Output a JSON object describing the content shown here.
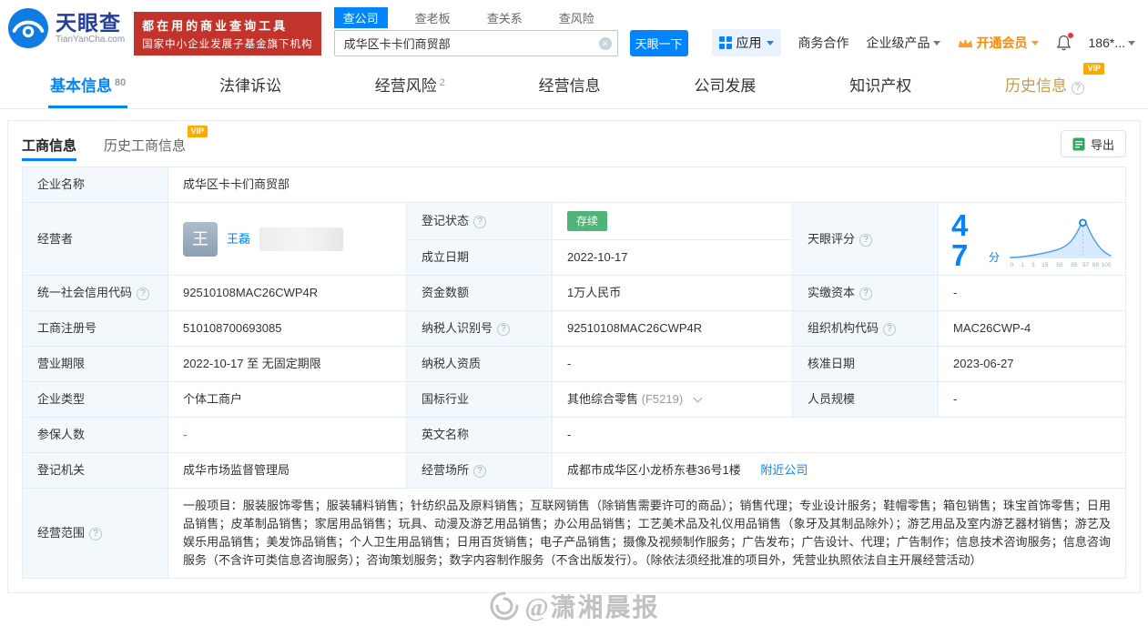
{
  "colors": {
    "accent": "#0084ff",
    "slogan_red": "#c2342b",
    "vip_gold": "#ffaa00",
    "status_green": "#4eb477"
  },
  "vip_label": "VIP",
  "header": {
    "brand": "天眼查",
    "brand_domain": "TianYanCha.com",
    "slogan1": "都在用的商业查询工具",
    "slogan2": "国家中小企业发展子基金旗下机构",
    "search_tabs": [
      {
        "label": "查公司",
        "active": true
      },
      {
        "label": "查老板",
        "active": false
      },
      {
        "label": "查关系",
        "active": false
      },
      {
        "label": "查风险",
        "active": false
      }
    ],
    "search_value": "成华区卡卡们商贸部",
    "search_button": "天眼一下",
    "nav_app": "应用",
    "nav_business": "商务合作",
    "nav_enterprise": "企业级产品",
    "nav_vip": "开通会员",
    "nav_account": "186*..."
  },
  "main_tabs": [
    {
      "label": "基本信息",
      "badge": "80"
    },
    {
      "label": "法律诉讼",
      "badge": ""
    },
    {
      "label": "经营风险",
      "badge": "2"
    },
    {
      "label": "经营信息",
      "badge": ""
    },
    {
      "label": "公司发展",
      "badge": ""
    },
    {
      "label": "知识产权",
      "badge": ""
    },
    {
      "label": "历史信息",
      "badge": ""
    }
  ],
  "subtabs": [
    {
      "label": "工商信息",
      "active": true
    },
    {
      "label": "历史工商信息",
      "active": false
    }
  ],
  "export_label": "导出",
  "info": {
    "company_name_label": "企业名称",
    "company_name": "成华区卡卡们商贸部",
    "operator_label": "经营者",
    "operator_avatar": "王",
    "operator_name": "王磊",
    "status_label": "登记状态",
    "status_value": "存续",
    "established_label": "成立日期",
    "established_value": "2022-10-17",
    "score_label": "天眼评分",
    "score_value": "47",
    "score_unit": "分",
    "score_ticks": [
      "0",
      "1",
      "3",
      "15",
      "50",
      "85",
      "97",
      "99",
      "100"
    ],
    "uscc_label": "统一社会信用代码",
    "uscc_value": "92510108MAC26CWP4R",
    "capital_label": "资金数额",
    "capital_value": "1万人民币",
    "paid_capital_label": "实缴资本",
    "paid_capital_value": "-",
    "reg_no_label": "工商注册号",
    "reg_no_value": "510108700693085",
    "taxpayer_id_label": "纳税人识别号",
    "taxpayer_id_value": "92510108MAC26CWP4R",
    "org_code_label": "组织机构代码",
    "org_code_value": "MAC26CWP-4",
    "term_label": "营业期限",
    "term_value": "2022-10-17 至 无固定期限",
    "taxpayer_qual_label": "纳税人资质",
    "taxpayer_qual_value": "-",
    "approval_label": "核准日期",
    "approval_value": "2023-06-27",
    "type_label": "企业类型",
    "type_value": "个体工商户",
    "industry_label": "国标行业",
    "industry_value": "其他综合零售",
    "industry_code": "(F5219)",
    "staff_label": "人员规模",
    "staff_value": "-",
    "insured_label": "参保人数",
    "insured_value": "-",
    "en_name_label": "英文名称",
    "en_name_value": "-",
    "authority_label": "登记机关",
    "authority_value": "成华市场监督管理局",
    "address_label": "经营场所",
    "address_value": "成都市成华区小龙桥东巷36号1楼",
    "address_link": "附近公司",
    "scope_label": "经营范围",
    "scope_value": "一般项目：服装服饰零售；服装辅料销售；针纺织品及原料销售；互联网销售（除销售需要许可的商品）；销售代理；专业设计服务；鞋帽零售；箱包销售；珠宝首饰零售；日用品销售；皮革制品销售；家居用品销售；玩具、动漫及游艺用品销售；办公用品销售；工艺美术品及礼仪用品销售（象牙及其制品除外）；游艺用品及室内游艺器材销售；游艺及娱乐用品销售；美发饰品销售；个人卫生用品销售；日用百货销售；电子产品销售；摄像及视频制作服务；广告发布；广告设计、代理；广告制作；信息技术咨询服务；信息咨询服务（不含许可类信息咨询服务）；咨询策划服务；数字内容制作服务（不含出版发行）。（除依法须经批准的项目外，凭营业执照依法自主开展经营活动）"
  },
  "watermark": "@潇湘晨报"
}
